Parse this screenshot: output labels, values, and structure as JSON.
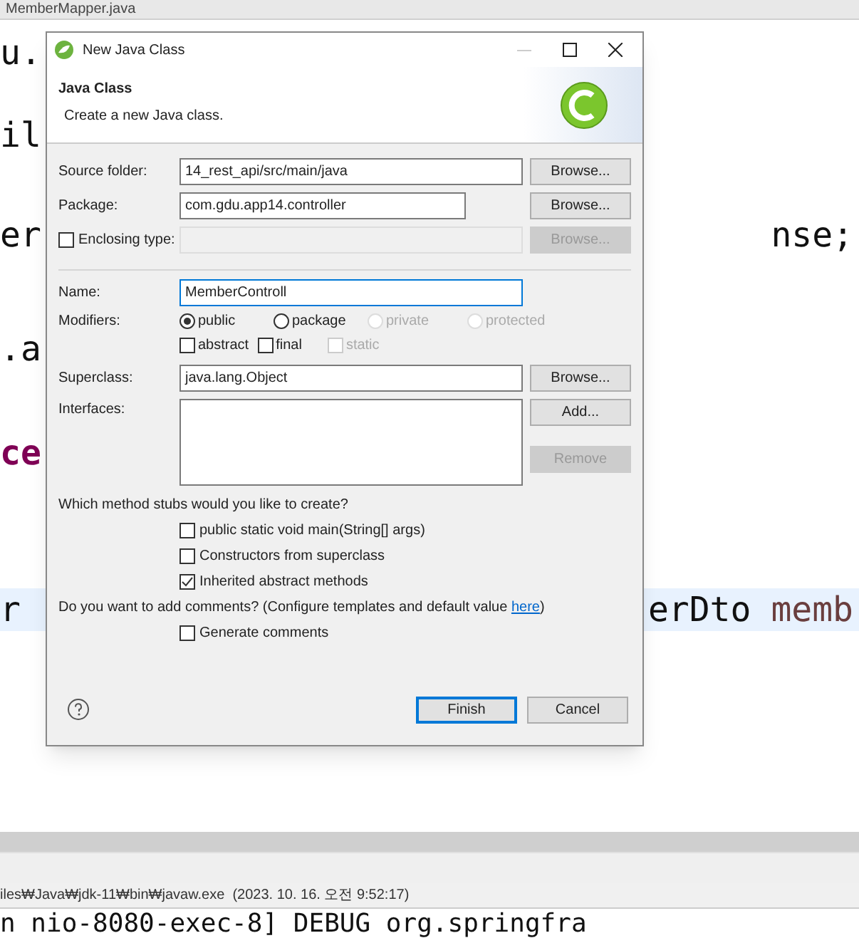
{
  "editor": {
    "tab": "MemberMapper.java",
    "lines": [
      {
        "left": {
          "text": "u.",
          "kind": "plain"
        },
        "current": false
      },
      {
        "left": {
          "text": "il",
          "kind": "plain"
        },
        "current": false
      },
      {
        "left": {
          "text": "er",
          "kind": "plain"
        },
        "right": [
          {
            "text": "nse;",
            "kind": "plain"
          }
        ],
        "current": false
      },
      {
        "left": {
          "text": ".a",
          "kind": "plain"
        },
        "current": false
      },
      {
        "left": {
          "text": "ce",
          "kind": "keyword"
        },
        "current": false
      },
      {
        "left": {
          "text": "r",
          "kind": "plain"
        },
        "right": [
          {
            "text": "erDto",
            "kind": "plain"
          },
          {
            "text": "memb",
            "kind": "variable"
          }
        ],
        "current": true
      }
    ]
  },
  "dialog": {
    "title": "New Java Class",
    "header": {
      "title": "Java Class",
      "description": "Create a new Java class."
    },
    "fields": [
      {
        "label": "Source folder:",
        "value": "14_rest_api/src/main/java",
        "button": {
          "label": "Browse...",
          "disabled": false
        },
        "wide": true
      },
      {
        "label": "Package:",
        "value": "com.gdu.app14.controller",
        "button": {
          "label": "Browse...",
          "disabled": false
        },
        "wide": false
      },
      {
        "label": "Enclosing type:",
        "checked": false,
        "disabled": true,
        "button": {
          "label": "Browse...",
          "disabled": true
        },
        "wide": true
      }
    ],
    "name": {
      "label": "Name:",
      "value": "MemberControll",
      "focused": true
    },
    "modifiers": {
      "label": "Modifiers:",
      "radios": [
        {
          "label": "public",
          "selected": true,
          "disabled": false
        },
        {
          "label": "package",
          "selected": false,
          "disabled": false
        },
        {
          "label": "private",
          "selected": false,
          "disabled": true
        },
        {
          "label": "protected",
          "selected": false,
          "disabled": true
        }
      ],
      "checkboxes": [
        {
          "label": "abstract",
          "checked": false,
          "disabled": false
        },
        {
          "label": "final",
          "checked": false,
          "disabled": false
        },
        {
          "label": "static",
          "checked": false,
          "disabled": true
        }
      ]
    },
    "superclass": {
      "label": "Superclass:",
      "value": "java.lang.Object",
      "button": {
        "label": "Browse...",
        "disabled": false
      }
    },
    "interfaces": {
      "label": "Interfaces:",
      "buttons": [
        {
          "label": "Add...",
          "disabled": false
        },
        {
          "label": "Remove",
          "disabled": true
        }
      ]
    },
    "stubs": {
      "question": "Which method stubs would you like to create?",
      "options": [
        {
          "label": "public static void main(String[] args)",
          "checked": false
        },
        {
          "label": "Constructors from superclass",
          "checked": false
        },
        {
          "label": "Inherited abstract methods",
          "checked": true
        }
      ]
    },
    "comments": {
      "question": "Do you want to add comments? (Configure templates and default value ",
      "link": "here",
      "closing": ")",
      "options": [
        {
          "label": "Generate comments",
          "checked": false
        }
      ]
    },
    "buttons": [
      {
        "label": "Finish",
        "default": true
      },
      {
        "label": "Cancel",
        "default": false
      }
    ]
  },
  "console": {
    "path": "iles₩Java₩jdk-11₩bin₩javaw.exe  (2023. 10. 16. 오전 9:52:17)",
    "line": "n nio-8080-exec-8] DEBUG org.springfra"
  }
}
